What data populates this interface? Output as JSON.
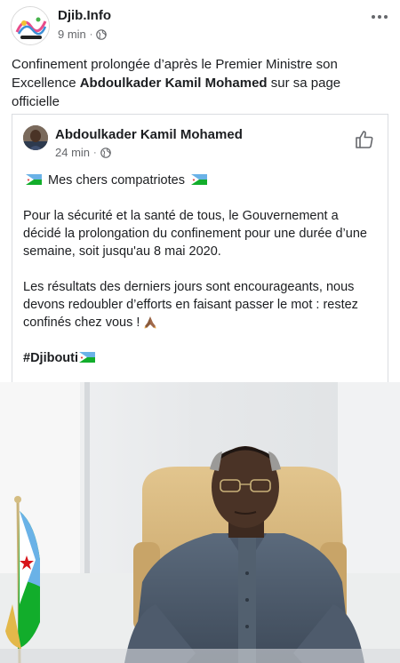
{
  "post": {
    "page_name": "Djib.Info",
    "time": "9 min",
    "separator": "·",
    "caption_pre": "Confinement prolongée d’après le Premier Ministre son Excellence ",
    "caption_bold": "Abdoulkader Kamil Mohamed",
    "caption_post": " sur sa page officielle",
    "more_icon": "more-horizontal-icon"
  },
  "shared": {
    "author_name": "Abdoulkader Kamil Mohamed",
    "time": "24 min",
    "separator": "·",
    "greeting": "Mes chers compatriotes",
    "paragraph1": "Pour la sécurité et la santé de tous, le Gouvernement a décidé la prolongation du confinement pour une durée d’une semaine, soit jusqu'au 8 mai 2020.",
    "paragraph2": "Les résultats des derniers jours sont encourageants, nous devons redoubler d’efforts en faisant passer le mot : restez confinés chez vous !",
    "hashtag": "#Djibouti",
    "like_icon": "thumbs-up-icon"
  },
  "colors": {
    "text": "#1c1e21",
    "meta": "#65676b",
    "djibouti_blue": "#6ab2e7",
    "djibouti_green": "#12ad2b",
    "djibouti_red": "#d7141a"
  }
}
